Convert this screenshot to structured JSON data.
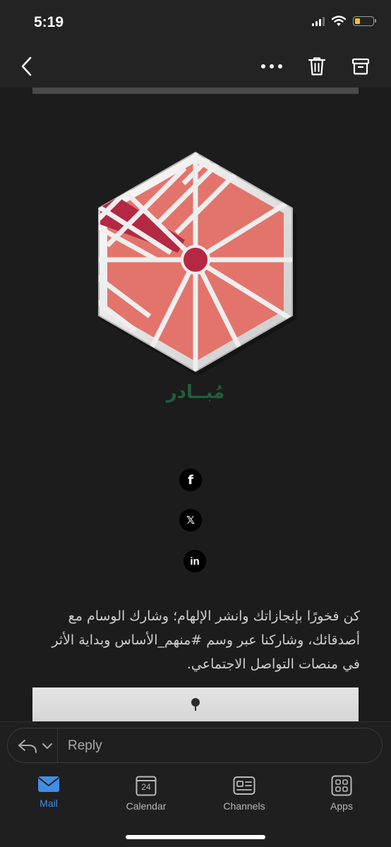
{
  "status_bar": {
    "time": "5:19",
    "icons": [
      "cellular-signal-icon",
      "wifi-icon",
      "battery-icon"
    ],
    "battery_color": "#f5c518"
  },
  "toolbar": {
    "back_icon": "chevron-left-icon",
    "more_icon": "ellipsis-icon",
    "delete_icon": "trash-icon",
    "archive_icon": "archive-icon"
  },
  "email": {
    "brand_name": "مُبــادر",
    "brand_color": "#1e5e3c",
    "badge_colors": {
      "fill": "#e3746c",
      "accent": "#b42843",
      "frame": "#eeeeee"
    },
    "social_links": [
      {
        "name": "facebook",
        "glyph": "f"
      },
      {
        "name": "x",
        "glyph": "𝕏"
      },
      {
        "name": "linkedin",
        "glyph": "in"
      }
    ],
    "body_text": "كن فخورًا بإنجازاتك وانشر الإلهام؛ وشارك الوسام مع أصدقائك، وشاركنا عبر وسم #منهم_الأساس وبداية الأثر في منصات التواصل الاجتماعي."
  },
  "reply_bar": {
    "placeholder": "Reply",
    "icon": "reply-icon"
  },
  "tab_bar": {
    "accent_color": "#3f8ee6",
    "tabs": [
      {
        "label": "Mail",
        "icon": "mail-icon",
        "active": true
      },
      {
        "label": "Calendar",
        "icon": "calendar-icon",
        "date_number": "24",
        "active": false
      },
      {
        "label": "Channels",
        "icon": "channels-icon",
        "active": false
      },
      {
        "label": "Apps",
        "icon": "apps-grid-icon",
        "active": false
      }
    ]
  }
}
